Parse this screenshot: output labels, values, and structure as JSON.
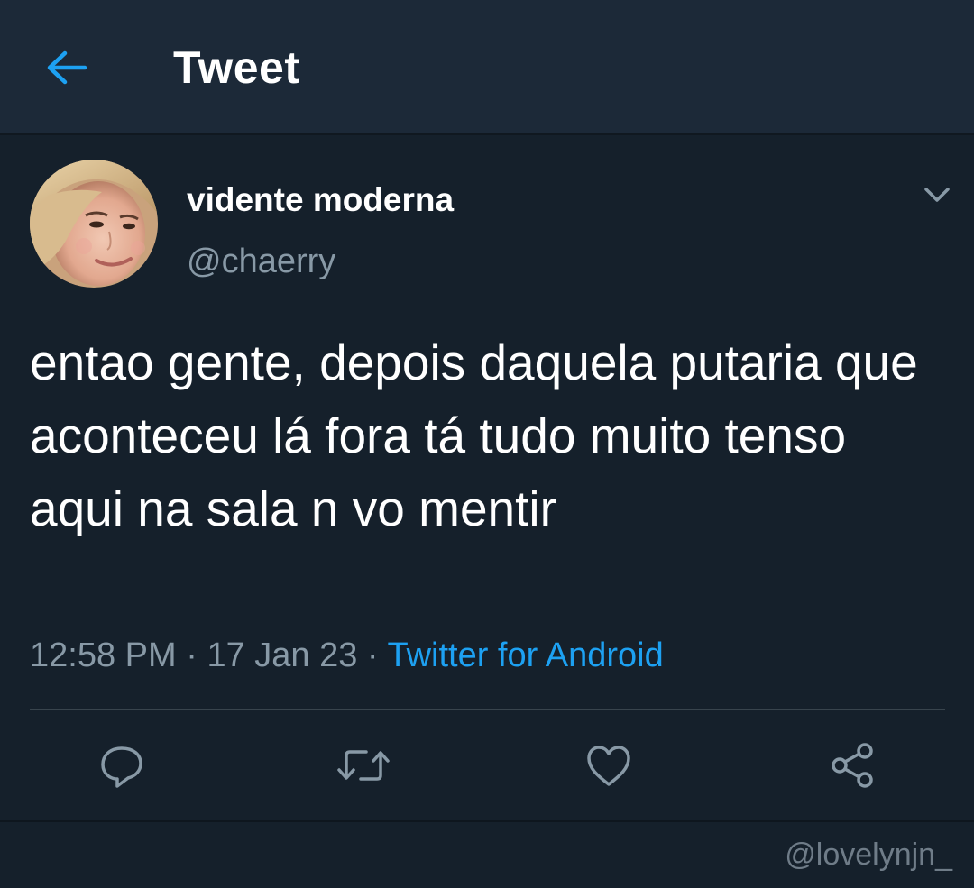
{
  "header": {
    "title": "Tweet",
    "back_icon": "arrow-left-icon"
  },
  "tweet": {
    "display_name": "vidente moderna",
    "handle": "@chaerry",
    "text": "entao gente, depois daquela putaria que aconteceu lá fora tá tudo muito tenso aqui na sala n vo mentir",
    "time": "12:58 PM",
    "separator": "·",
    "date": "17 Jan 23",
    "source": "Twitter for Android"
  },
  "actions": {
    "icons": [
      "reply-icon",
      "retweet-icon",
      "like-icon",
      "share-icon"
    ]
  },
  "watermark": "@lovelynjn_",
  "colors": {
    "background": "#15202b",
    "header_bg": "#1c2938",
    "accent": "#1da1f2",
    "secondary_text": "#8899a6"
  }
}
